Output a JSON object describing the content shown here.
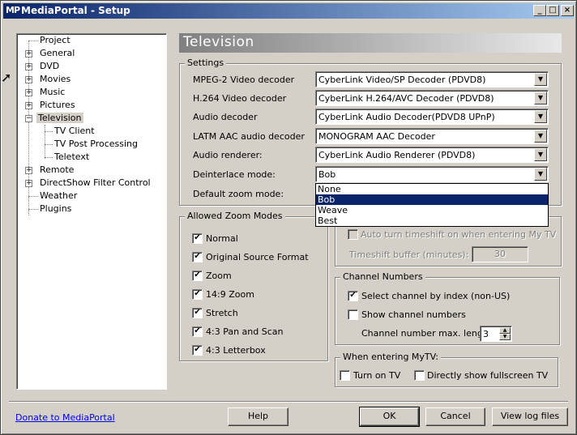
{
  "window": {
    "title": "MediaPortal - Setup",
    "app_icon": "MP",
    "controls": {
      "minimize": "_",
      "maximize": "□",
      "close": "×"
    }
  },
  "tree": {
    "items": [
      {
        "label": "Project",
        "expander": ""
      },
      {
        "label": "General",
        "expander": "+"
      },
      {
        "label": "DVD",
        "expander": "+"
      },
      {
        "label": "Movies",
        "expander": "+"
      },
      {
        "label": "Music",
        "expander": "+"
      },
      {
        "label": "Pictures",
        "expander": "+"
      },
      {
        "label": "Television",
        "expander": "−"
      },
      {
        "label": "TV Client",
        "expander": ""
      },
      {
        "label": "TV Post Processing",
        "expander": ""
      },
      {
        "label": "Teletext",
        "expander": ""
      },
      {
        "label": "Remote",
        "expander": "+"
      },
      {
        "label": "DirectShow Filter Control",
        "expander": "+"
      },
      {
        "label": "Weather",
        "expander": ""
      },
      {
        "label": "Plugins",
        "expander": ""
      }
    ],
    "selected": "Television"
  },
  "section": {
    "title": "Television"
  },
  "settings": {
    "group_title": "Settings",
    "rows": [
      {
        "label": "MPEG-2 Video decoder",
        "value": "CyberLink Video/SP Decoder (PDVD8)"
      },
      {
        "label": "H.264 Video decoder",
        "value": "CyberLink H.264/AVC Decoder (PDVD8)"
      },
      {
        "label": "Audio decoder",
        "value": "CyberLink Audio Decoder(PDVD8 UPnP)"
      },
      {
        "label": "LATM AAC audio decoder",
        "value": "MONOGRAM AAC Decoder"
      },
      {
        "label": "Audio renderer:",
        "value": "CyberLink Audio Renderer (PDVD8)"
      },
      {
        "label": "Deinterlace mode:",
        "value": "Bob"
      }
    ],
    "default_zoom_label": "Default zoom mode:",
    "deinterlace_options": [
      "None",
      "Bob",
      "Weave",
      "Best"
    ],
    "deinterlace_selected": "Bob"
  },
  "zoom_modes": {
    "group_title": "Allowed Zoom Modes",
    "items": [
      {
        "label": "Normal",
        "checked": "✔"
      },
      {
        "label": "Original Source Format",
        "checked": "✔"
      },
      {
        "label": "Zoom",
        "checked": "✔"
      },
      {
        "label": "14:9 Zoom",
        "checked": "✔"
      },
      {
        "label": "Stretch",
        "checked": "✔"
      },
      {
        "label": "4:3 Pan and Scan",
        "checked": "✔"
      },
      {
        "label": "4:3 Letterbox",
        "checked": "✔"
      }
    ]
  },
  "timeshift": {
    "auto_label": "Auto turn timeshift on when entering My TV",
    "buffer_label": "Timeshift buffer (minutes):",
    "buffer_value": "30"
  },
  "channel_numbers": {
    "group_title": "Channel Numbers",
    "select_by_index": {
      "label": "Select channel by index (non-US)",
      "checked": "✔"
    },
    "show_numbers": {
      "label": "Show channel numbers",
      "checked": ""
    },
    "max_length_label": "Channel number max. length",
    "max_length_value": "3"
  },
  "entering_mytv": {
    "group_title": "When entering MyTV:",
    "turn_on_tv": "Turn on TV",
    "fullscreen": "Directly show fullscreen TV"
  },
  "footer": {
    "donate_link": "Donate to MediaPortal",
    "help": "Help",
    "ok": "OK",
    "cancel": "Cancel",
    "view_log": "View log files"
  },
  "colors": {
    "face": "#d4d0c8",
    "title_start": "#0a246a",
    "title_end": "#a6caf0",
    "selection": "#0a246a"
  }
}
